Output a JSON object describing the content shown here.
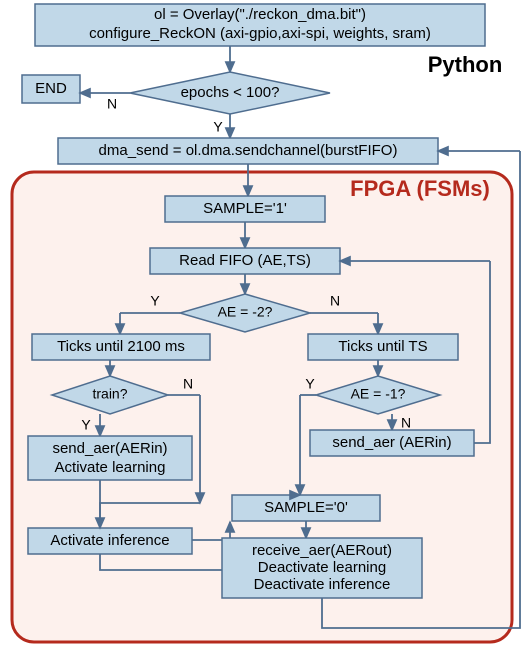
{
  "labels": {
    "python": "Python",
    "fpga": "FPGA (FSMs)"
  },
  "nodes": {
    "init1": "ol = Overlay(\"./reckon_dma.bit\")",
    "init2": "configure_ReckON (axi-gpio,axi-spi, weights, sram)",
    "end": "END",
    "epochs": "epochs < 100?",
    "dma": "dma_send = ol.dma.sendchannel(burstFIFO)",
    "sample1": "SAMPLE='1'",
    "readfifo": "Read FIFO (AE,TS)",
    "ae_neg2": "AE = -2?",
    "ticks2100": "Ticks until 2100 ms",
    "ticksTS": "Ticks until TS",
    "train": "train?",
    "ae_neg1": "AE = -1?",
    "send_aer_left1": "send_aer(AERin)",
    "send_aer_left2": "Activate learning",
    "send_aer_right": "send_aer (AERin)",
    "act_inf": "Activate inference",
    "sample0": "SAMPLE='0'",
    "recv1": "receive_aer(AERout)",
    "recv2": "Deactivate learning",
    "recv3": "Deactivate inference"
  },
  "edges": {
    "Y": "Y",
    "N": "N"
  },
  "chart_data": {
    "type": "flowchart",
    "nodes": [
      {
        "id": "init",
        "type": "process",
        "label": "ol = Overlay(\"./reckon_dma.bit\"); configure_ReckON(axi-gpio,axi-spi,weights,sram)"
      },
      {
        "id": "epochs",
        "type": "decision",
        "label": "epochs < 100?"
      },
      {
        "id": "end",
        "type": "terminator",
        "label": "END"
      },
      {
        "id": "dma",
        "type": "process",
        "label": "dma_send = ol.dma.sendchannel(burstFIFO)"
      },
      {
        "id": "sample1",
        "type": "process",
        "label": "SAMPLE='1'"
      },
      {
        "id": "readfifo",
        "type": "process",
        "label": "Read FIFO (AE,TS)"
      },
      {
        "id": "ae2",
        "type": "decision",
        "label": "AE = -2?"
      },
      {
        "id": "ticks2100",
        "type": "process",
        "label": "Ticks until 2100 ms"
      },
      {
        "id": "ticksTS",
        "type": "process",
        "label": "Ticks until TS"
      },
      {
        "id": "train",
        "type": "decision",
        "label": "train?"
      },
      {
        "id": "ae1",
        "type": "decision",
        "label": "AE = -1?"
      },
      {
        "id": "sendL",
        "type": "process",
        "label": "send_aer(AERin); Activate learning"
      },
      {
        "id": "sendR",
        "type": "process",
        "label": "send_aer(AERin)"
      },
      {
        "id": "actinf",
        "type": "process",
        "label": "Activate inference"
      },
      {
        "id": "sample0",
        "type": "process",
        "label": "SAMPLE='0'"
      },
      {
        "id": "recv",
        "type": "process",
        "label": "receive_aer(AERout); Deactivate learning; Deactivate inference"
      }
    ],
    "edges": [
      {
        "from": "init",
        "to": "epochs"
      },
      {
        "from": "epochs",
        "to": "end",
        "label": "N"
      },
      {
        "from": "epochs",
        "to": "dma",
        "label": "Y"
      },
      {
        "from": "dma",
        "to": "sample1"
      },
      {
        "from": "sample1",
        "to": "readfifo"
      },
      {
        "from": "readfifo",
        "to": "ae2"
      },
      {
        "from": "ae2",
        "to": "ticks2100",
        "label": "Y"
      },
      {
        "from": "ae2",
        "to": "ticksTS",
        "label": "N"
      },
      {
        "from": "ticks2100",
        "to": "train"
      },
      {
        "from": "ticksTS",
        "to": "ae1"
      },
      {
        "from": "train",
        "to": "sendL",
        "label": "Y"
      },
      {
        "from": "train",
        "to": "actinf",
        "label": "N"
      },
      {
        "from": "ae1",
        "to": "sample0",
        "label": "Y"
      },
      {
        "from": "ae1",
        "to": "sendR",
        "label": "N"
      },
      {
        "from": "sendR",
        "to": "readfifo"
      },
      {
        "from": "sendL",
        "to": "sample0"
      },
      {
        "from": "actinf",
        "to": "sample0"
      },
      {
        "from": "sample0",
        "to": "recv"
      },
      {
        "from": "recv",
        "to": "dma"
      }
    ],
    "regions": [
      {
        "name": "Python",
        "contains": [
          "init",
          "epochs",
          "end",
          "dma"
        ]
      },
      {
        "name": "FPGA (FSMs)",
        "contains": [
          "sample1",
          "readfifo",
          "ae2",
          "ticks2100",
          "ticksTS",
          "train",
          "ae1",
          "sendL",
          "sendR",
          "actinf",
          "sample0",
          "recv"
        ]
      }
    ]
  }
}
